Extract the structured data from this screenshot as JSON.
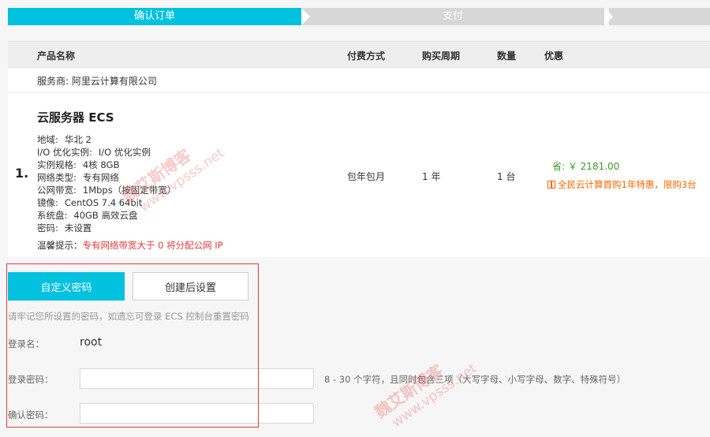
{
  "steps": [
    "确认订单",
    "支付"
  ],
  "table_header": {
    "product_name": "产品名称",
    "payment_method": "付费方式",
    "purchase_period": "购买周期",
    "quantity": "数量",
    "discount": "优惠"
  },
  "provider": "服务商: 阿里云计算有限公司",
  "product": {
    "index": "1.",
    "title": "云服务器 ECS",
    "specs": [
      {
        "key": "地域:",
        "value": "华北 2"
      },
      {
        "key": "I/O 优化实例:",
        "value": "I/O 优化实例"
      },
      {
        "key": "实例规格:",
        "value": "4核 8GB"
      },
      {
        "key": "网络类型:",
        "value": "专有网络"
      },
      {
        "key": "公网带宽:",
        "value": "1Mbps（按固定带宽）"
      },
      {
        "key": "镜像:",
        "value": "CentOS 7.4 64bit"
      },
      {
        "key": "系统盘:",
        "value": "40GB 高效云盘"
      },
      {
        "key": "密码:",
        "value": "未设置"
      }
    ],
    "payment": "包年包月",
    "period": "1 年",
    "quantity": "1 台",
    "saving": "省: ￥ 2181.00",
    "promo": "全民云计算首购1年特惠，限购3台",
    "hint_label": "温馨提示：",
    "hint_text": "专有网络带宽大于 0 将分配公网 IP"
  },
  "password": {
    "custom_button": "自定义密码",
    "later_button": "创建后设置",
    "note": "请牢记您所设置的密码，如遗忘可登录 ECS 控制台重置密码",
    "login_label": "登录名：",
    "login_value": "root",
    "password_label": "登录密码：",
    "confirm_label": "确认密码：",
    "rule": "8 - 30 个字符，且同时包含三项（大写字母、小写字母、数字、特殊符号）"
  },
  "watermark": {
    "text": "魏艾斯博客",
    "url": "www.vpsss.net"
  },
  "colors": {
    "accent": "#00c1de",
    "inactive_step": "#d7d7d7",
    "saving": "#3c9a2a",
    "promo": "#ff6600",
    "warning": "#e4393c",
    "highlight_box": "#e23a3a"
  }
}
